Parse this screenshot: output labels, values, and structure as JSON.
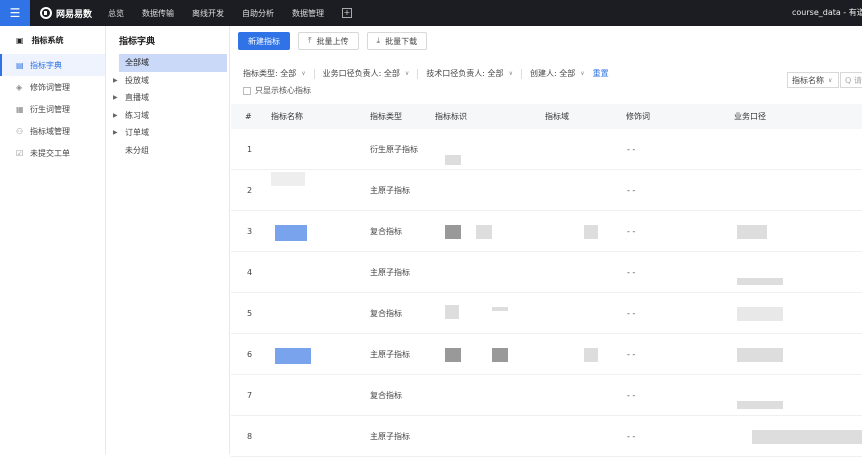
{
  "topbar": {
    "menu_icon": "hamburger-icon",
    "logo_text": "网易易数",
    "nav": [
      "总览",
      "数据传输",
      "离线开发",
      "自助分析",
      "数据管理"
    ],
    "project": "course_data - 有道"
  },
  "sidebar": {
    "title": "指标系统",
    "items": [
      {
        "label": "指标字典",
        "icon": "book-icon"
      },
      {
        "label": "修饰词管理",
        "icon": "tag-icon"
      },
      {
        "label": "衍生词管理",
        "icon": "grid-icon"
      },
      {
        "label": "指标域管理",
        "icon": "nodes-icon"
      },
      {
        "label": "未提交工单",
        "icon": "form-icon"
      }
    ]
  },
  "tree": {
    "title": "指标字典",
    "items": [
      "全部域",
      "投放域",
      "直播域",
      "练习域",
      "订单域",
      "未分组"
    ]
  },
  "toolbar": {
    "new_label": "新建指标",
    "upload_label": "批量上传",
    "download_label": "批量下载"
  },
  "filters": {
    "type": "指标类型: 全部",
    "biz_owner": "业务口径负责人: 全部",
    "tech_owner": "技术口径负责人: 全部",
    "creator": "创建人: 全部",
    "reset": "重置",
    "core_only": "只显示核心指标",
    "search_field": "指标名称",
    "search_placeholder": "Q 请"
  },
  "table": {
    "headers": [
      "#",
      "指标名称",
      "指标类型",
      "指标标识",
      "指标域",
      "修饰词",
      "业务口径"
    ],
    "rows": [
      {
        "idx": "1",
        "type": "衍生原子指标",
        "modifier": "- -"
      },
      {
        "idx": "2",
        "type": "主原子指标",
        "modifier": "- -"
      },
      {
        "idx": "3",
        "type": "复合指标",
        "modifier": "- -"
      },
      {
        "idx": "4",
        "type": "主原子指标",
        "modifier": "- -"
      },
      {
        "idx": "5",
        "type": "复合指标",
        "modifier": "- -"
      },
      {
        "idx": "6",
        "type": "主原子指标",
        "modifier": "- -"
      },
      {
        "idx": "7",
        "type": "复合指标",
        "modifier": "- -"
      },
      {
        "idx": "8",
        "type": "主原子指标",
        "modifier": "- -"
      }
    ]
  }
}
